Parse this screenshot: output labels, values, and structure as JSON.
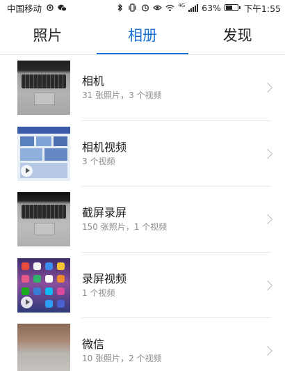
{
  "status_bar": {
    "carrier": "中国移动",
    "battery_level": "63%",
    "battery_fraction": 0.63,
    "network_label": "4G",
    "time": "下午1:55",
    "icons": [
      "signal-dot-icon",
      "wechat-icon",
      "bluetooth-icon",
      "vibrate-icon",
      "alarm-icon",
      "eye-icon",
      "wifi-icon",
      "cell-signal-icon",
      "battery-icon"
    ]
  },
  "tabs": [
    {
      "label": "照片",
      "active": false
    },
    {
      "label": "相册",
      "active": true
    },
    {
      "label": "发现",
      "active": false
    }
  ],
  "colors": {
    "accent": "#1a73d9",
    "title": "#1b1b1b",
    "secondary": "#8a8a8a",
    "divider": "#e8e8e8",
    "chevron": "#b9b9b9"
  },
  "albums": [
    {
      "title": "相机",
      "count": "31 张照片，3 个视频",
      "thumbnail": "laptop-photo",
      "is_video_album": false
    },
    {
      "title": "相机视频",
      "count": "3 个视频",
      "thumbnail": "screen-photo",
      "is_video_album": true
    },
    {
      "title": "截屏录屏",
      "count": "150 张照片，1 个视频",
      "thumbnail": "laptop-photo",
      "is_video_album": false
    },
    {
      "title": "录屏视频",
      "count": "1 个视频",
      "thumbnail": "phone-homescreen",
      "is_video_album": true
    },
    {
      "title": "微信",
      "count": "10 张照片，2 个视频",
      "thumbnail": "wechat-photo",
      "is_video_album": false
    }
  ]
}
